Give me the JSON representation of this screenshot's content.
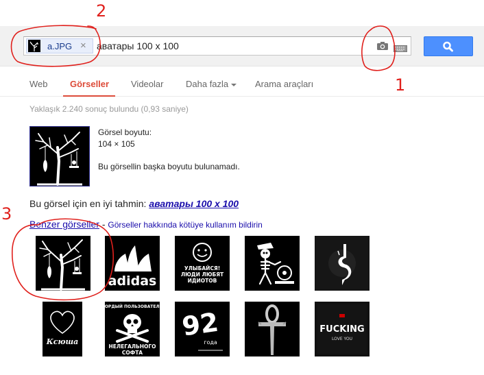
{
  "search": {
    "chip_label": "a.JPG",
    "chip_remove": "×",
    "query": "аватары 100 х 100"
  },
  "tabs": [
    {
      "label": "Web",
      "active": false
    },
    {
      "label": "Görseller",
      "active": true
    },
    {
      "label": "Videolar",
      "active": false
    },
    {
      "label": "Daha fazla",
      "active": false
    },
    {
      "label": "Arama araçları",
      "active": false
    }
  ],
  "results": {
    "stats": "Yaklaşık 2.240 sonuç bulundu (0,93 saniye)",
    "image_size_label": "Görsel boyutu:",
    "image_size_value": "104 × 105",
    "no_other_sizes": "Bu görsellin başka boyutu bulunamadı.",
    "best_guess_prefix": "Bu görsel için en iyi tahmin:",
    "best_guess_query": "аватары 100 х 100",
    "similar_label": "Benzer görseller",
    "similar_dash": " - ",
    "report_link": "Görseller hakkında kötüye kullanım bildirin"
  },
  "similar_images": [
    {
      "name": "tree-swing"
    },
    {
      "name": "adidas",
      "text": "adidas"
    },
    {
      "name": "smiley",
      "lines": [
        "УЛЫБАЙСЯ!",
        "ЛЮДИ ЛЮБЯТ",
        "ИДИОТОВ"
      ]
    },
    {
      "name": "skeleton-dj"
    },
    {
      "name": "slipknot"
    },
    {
      "name": "heart",
      "text": "Ксюша"
    },
    {
      "name": "skull",
      "lines": [
        "ГОРДЫЙ ПОЛЬЗОВАТЕЛЬ",
        "НЕЛЕГАЛЬНОГО",
        "СОФТА"
      ]
    },
    {
      "name": "number-92",
      "text": "92",
      "sub": "года"
    },
    {
      "name": "ankh"
    },
    {
      "name": "fucking",
      "text": "FUCKING",
      "sub": "LOVE YOU"
    }
  ],
  "annotations": [
    "2",
    "1",
    "3"
  ],
  "colors": {
    "accent_red": "#dd4b39",
    "link_blue": "#1a0dab",
    "search_blue": "#4d90fe",
    "annotation_red": "#e0201c"
  }
}
